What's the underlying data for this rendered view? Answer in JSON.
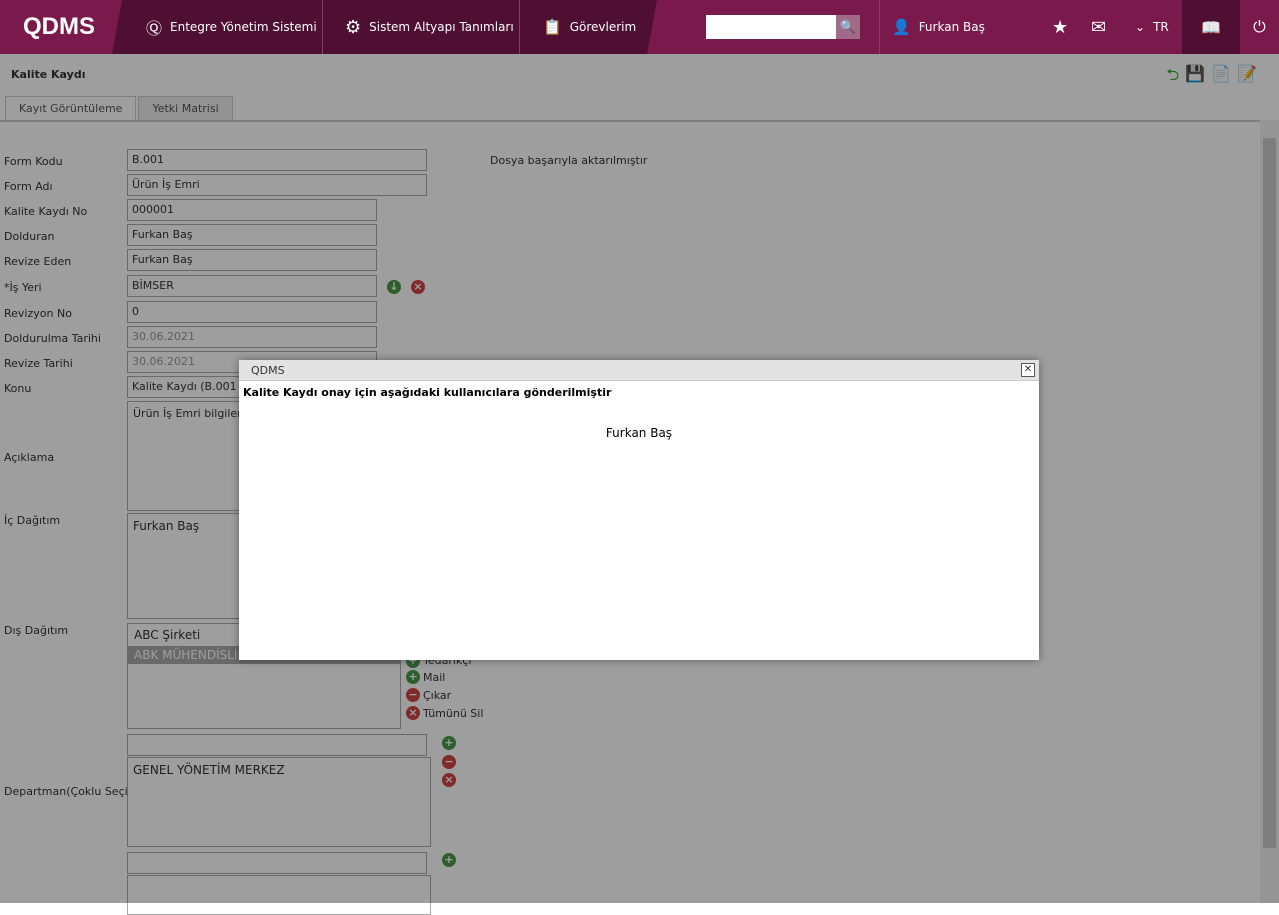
{
  "header": {
    "logo": "QDMS",
    "nav": [
      "Entegre Yönetim Sistemi",
      "Sistem Altyapı Tanımları",
      "Görevlerim"
    ],
    "search_placeholder": "",
    "user": "Furkan Baş",
    "lang": "TR"
  },
  "page": {
    "title": "Kalite Kaydı",
    "tabs": [
      "Kayıt Görüntüleme",
      "Yetki Matrisi"
    ],
    "status": "Dosya başarıyla aktarılmıştır"
  },
  "form": [
    {
      "label": "Form Kodu",
      "value": "B.001"
    },
    {
      "label": "Form Adı",
      "value": "Ürün İş Emri"
    },
    {
      "label": "Kalite Kaydı No",
      "value": "000001"
    },
    {
      "label": "Dolduran",
      "value": "Furkan Baş"
    },
    {
      "label": "Revize Eden",
      "value": "Furkan Baş"
    },
    {
      "label": "*İş Yeri",
      "value": "BİMSER"
    },
    {
      "label": "Revizyon No",
      "value": "0"
    },
    {
      "label": "Doldurulma Tarihi",
      "value": "30.06.2021"
    },
    {
      "label": "Revize Tarihi",
      "value": "30.06.2021"
    },
    {
      "label": "Konu",
      "value": "Kalite Kaydı (B.001 - 0"
    },
    {
      "label": "Açıklama",
      "value": "Ürün İş Emri bilgilerini"
    },
    {
      "label": "İç Dağıtım",
      "value": "Furkan Baş"
    },
    {
      "label": "Dış Dağıtım",
      "values": [
        "ABC Şirketi",
        "ABK MÜHENDİSLİK"
      ]
    },
    {
      "label": "Departman(Çoklu Seçim)",
      "value": "GENEL YÖNETİM MERKEZ"
    }
  ],
  "dis_actions": [
    "Tedarikçi",
    "Mail",
    "Çıkar",
    "Tümünü Sil"
  ],
  "modal": {
    "title": "QDMS",
    "message": "Kalite Kaydı onay için aşağıdaki kullanıcılara gönderilmiştir",
    "users": [
      "Furkan Baş"
    ]
  }
}
